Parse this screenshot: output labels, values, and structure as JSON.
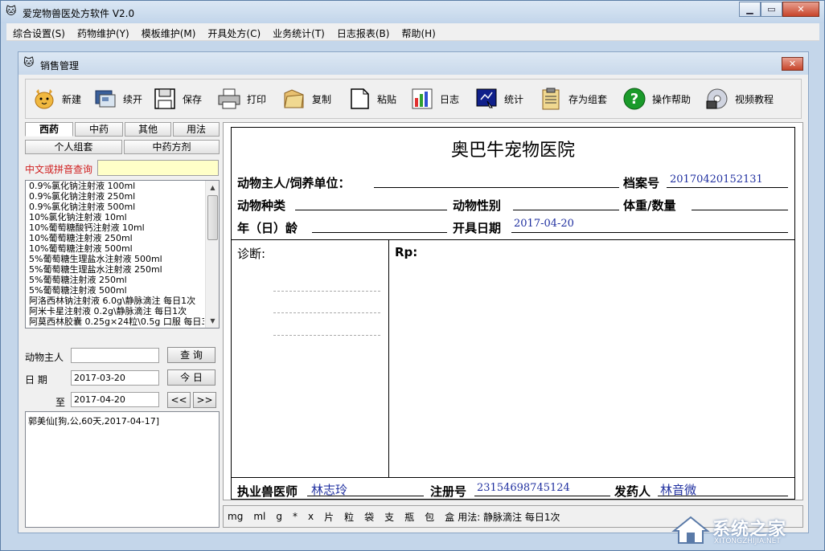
{
  "window": {
    "title": "爱宠物兽医处方软件 V2.0"
  },
  "menu": [
    "综合设置(S)",
    "药物维护(Y)",
    "模板维护(M)",
    "开具处方(C)",
    "业务统计(T)",
    "日志报表(B)",
    "帮助(H)"
  ],
  "child": {
    "title": "销售管理"
  },
  "toolbar": {
    "new": "新建",
    "continue": "续开",
    "save": "保存",
    "print": "打印",
    "copy": "复制",
    "paste": "粘贴",
    "log": "日志",
    "stats": "统计",
    "save_group": "存为组套",
    "help": "操作帮助",
    "video": "视频教程"
  },
  "left": {
    "tabs": [
      "西药",
      "中药",
      "其他",
      "用法"
    ],
    "tabs2": [
      "个人组套",
      "中药方剂"
    ],
    "search_label": "中文或拼音查询",
    "search_value": "",
    "drugs": [
      "0.9%氯化钠注射液  100ml",
      "0.9%氯化钠注射液  250ml",
      "0.9%氯化钠注射液  500ml",
      "10%氯化钠注射液  10ml",
      "10%葡萄糖酸钙注射液  10ml",
      "10%葡萄糖注射液  250ml",
      "10%葡萄糖注射液  500ml",
      "5%葡萄糖生理盐水注射液  500ml",
      "5%葡萄糖生理盐水注射液 250ml",
      "5%葡萄糖注射液  250ml",
      "5%葡萄糖注射液  500ml",
      "阿洛西林钠注射液 6.0g\\静脉滴注  每日1次",
      "阿米卡星注射液  0.2g\\静脉滴注  每日1次",
      "阿莫西林胶囊 0.25g×24粒\\0.5g 口服 每日3"
    ],
    "owner_label": "动物主人",
    "owner_value": "",
    "query_btn": "查  询",
    "date_label": "日  期",
    "date_from": "2017-03-20",
    "today_btn": "今  日",
    "to_label": "至",
    "date_to": "2017-04-20",
    "prev_btn": "<<",
    "next_btn": ">>",
    "history": [
      "郭美仙[狗,公,60天,2017-04-17]"
    ]
  },
  "rx": {
    "hospital": "奥巴牛宠物医院",
    "owner_label": "动物主人/饲养单位：",
    "owner_value": "",
    "file_label": "档案号",
    "file_value": "20170420152131",
    "species_label": "动物种类",
    "sex_label": "动物性别",
    "weight_label": "体重/数量",
    "age_label": "年（日）龄",
    "date_label": "开具日期",
    "date_value": "2017-04-20",
    "diagnosis_label": "诊断:",
    "rp_label": "Rp:",
    "vet_label": "执业兽医师",
    "vet_value": "林志玲",
    "reg_label": "注册号",
    "reg_value": "23154698745124",
    "disp_label": "发药人",
    "disp_value": "林音微"
  },
  "units": [
    "mg",
    "ml",
    "g",
    "*",
    "x",
    "片",
    "粒",
    "袋",
    "支",
    "瓶",
    "包",
    "盒"
  ],
  "usage_text": "用法: 静脉滴注 每日1次",
  "watermark": {
    "text": "系统之家",
    "sub": "XITONGZHIJIA.NET"
  }
}
